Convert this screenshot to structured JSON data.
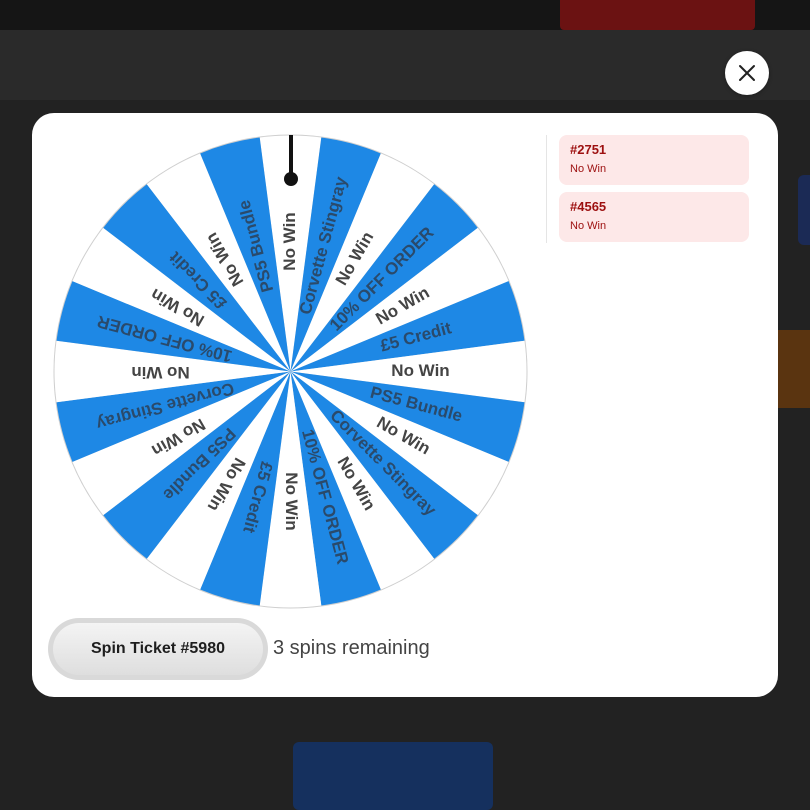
{
  "colors": {
    "segment_blue": "#1e88e5",
    "segment_white": "#ffffff",
    "result_bg": "#fde8e8",
    "result_text": "#9d1010"
  },
  "close_icon": "close-icon",
  "wheel": {
    "segments": [
      {
        "label": "No Win"
      },
      {
        "label": "Corvette Stingray"
      },
      {
        "label": "No Win"
      },
      {
        "label": "10% OFF ORDER"
      },
      {
        "label": "No Win"
      },
      {
        "label": "£5 Credit"
      },
      {
        "label": "No Win"
      },
      {
        "label": "PS5 Bundle"
      },
      {
        "label": "No Win"
      },
      {
        "label": "Corvette Stingray"
      },
      {
        "label": "No Win"
      },
      {
        "label": "10% OFF ORDER"
      },
      {
        "label": "No Win"
      },
      {
        "label": "£5 Credit"
      },
      {
        "label": "No Win"
      },
      {
        "label": "PS5 Bundle"
      },
      {
        "label": "No Win"
      },
      {
        "label": "Corvette Stingray"
      },
      {
        "label": "No Win"
      },
      {
        "label": "10% OFF ORDER"
      },
      {
        "label": "No Win"
      },
      {
        "label": "£5 Credit"
      },
      {
        "label": "No Win"
      },
      {
        "label": "PS5 Bundle"
      }
    ]
  },
  "results": [
    {
      "id": "#2751",
      "status": "No Win"
    },
    {
      "id": "#4565",
      "status": "No Win"
    }
  ],
  "spin": {
    "button_label": "Spin Ticket #5980",
    "remaining_text": "3 spins remaining"
  }
}
